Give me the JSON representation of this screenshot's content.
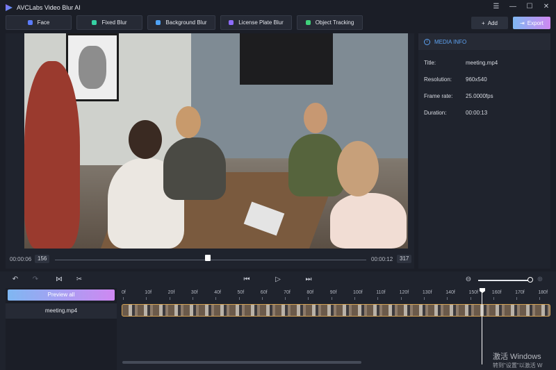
{
  "app": {
    "title": "AVCLabs Video Blur AI"
  },
  "window_controls": {
    "menu": "☰",
    "minimize": "—",
    "maximize": "☐",
    "close": "✕"
  },
  "tools": [
    {
      "label": "Face",
      "color": "#5b7cff"
    },
    {
      "label": "Fixed Blur",
      "color": "#36d1a3"
    },
    {
      "label": "Background Blur",
      "color": "#4fa3f7"
    },
    {
      "label": "License Plate Blur",
      "color": "#8d6cff"
    },
    {
      "label": "Object Tracking",
      "color": "#3fd17a"
    }
  ],
  "actions": {
    "add": "Add",
    "export": "Export"
  },
  "player": {
    "current_time": "00:00:06",
    "current_frame": "156",
    "end_time": "00:00:12",
    "end_frame": "317",
    "progress": 0.49
  },
  "media_info": {
    "header": "MEDIA INFO",
    "rows": [
      {
        "label": "Title:",
        "value": "meeting.mp4"
      },
      {
        "label": "Resolution:",
        "value": "960x540"
      },
      {
        "label": "Frame rate:",
        "value": "25.0000fps"
      },
      {
        "label": "Duration:",
        "value": "00:00:13"
      }
    ]
  },
  "timeline": {
    "preview_all": "Preview all",
    "track_name": "meeting.mp4",
    "ruler": [
      "0f",
      "10f",
      "20f",
      "30f",
      "40f",
      "50f",
      "60f",
      "70f",
      "80f",
      "90f",
      "100f",
      "110f",
      "120f",
      "130f",
      "140f",
      "150f",
      "160f",
      "170f",
      "180f"
    ],
    "zoom_level": 1.0
  },
  "watermark": {
    "line1": "激活 Windows",
    "line2": "转到\"设置\"以激活 W"
  }
}
